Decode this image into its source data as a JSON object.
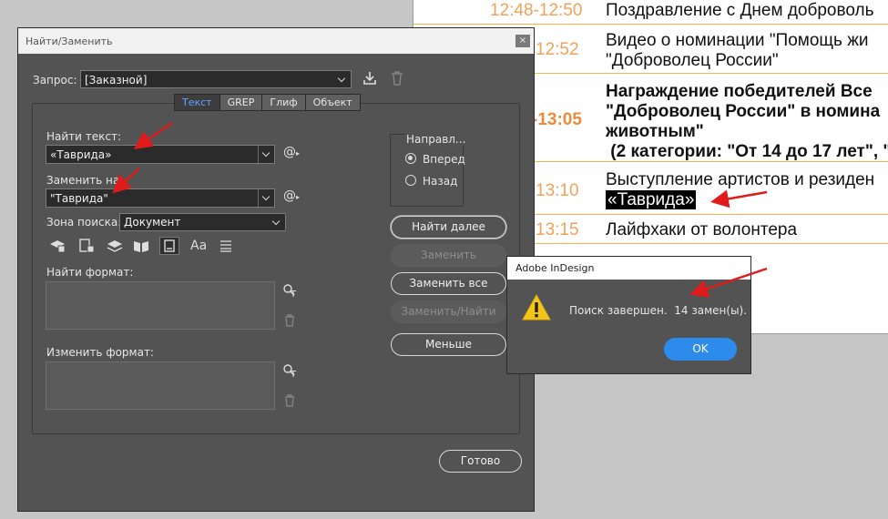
{
  "document": {
    "rows": [
      {
        "time": "12:48-12:50",
        "lines": [
          "Поздравление с Днем доброволь"
        ],
        "bold": false
      },
      {
        "time": "12:52",
        "lines": [
          "Видео о номинации \"Помощь жи",
          "\"Доброволец России\""
        ],
        "bold": false
      },
      {
        "time": "-13:05",
        "lines": [
          "Награждение победителей Все",
          "\"Доброволец России\" в номина",
          "животным\"",
          " (2 категории: \"От 14 до 17 лет\", \""
        ],
        "bold": true
      },
      {
        "time": "13:10",
        "lines": [
          "Выступление артистов и резиден"
        ],
        "highlight": "«Таврида»",
        "bold": false
      },
      {
        "time": "13:15",
        "lines": [
          "Лайфхаки от волонтера"
        ],
        "bold": false
      }
    ]
  },
  "dialog": {
    "title": "Найти/Заменить",
    "close": "×",
    "query_label": "Запрос:",
    "query_value": "[Заказной]",
    "tabs": [
      {
        "label": "Текст",
        "active": true
      },
      {
        "label": "GREP",
        "active": false
      },
      {
        "label": "Глиф",
        "active": false
      },
      {
        "label": "Объект",
        "active": false
      }
    ],
    "find_label": "Найти текст:",
    "find_value": "«Таврида»",
    "replace_label": "Заменить на:",
    "replace_value": "\"Таврида\"",
    "at_symbol": "@",
    "scope_label": "Зона поиска:",
    "scope_value": "Документ",
    "find_format_label": "Найти формат:",
    "change_format_label": "Изменить формат:",
    "direction": {
      "title": "Направл...",
      "forward": "Вперед",
      "back": "Назад"
    },
    "buttons": {
      "find_next": "Найти далее",
      "replace": "Заменить",
      "replace_all": "Заменить все",
      "replace_find": "Заменить/Найти",
      "less": "Меньше",
      "done": "Готово"
    }
  },
  "alert": {
    "title": "Adobe InDesign",
    "message": "Поиск завершен.  14 замен(ы).",
    "ok": "OK"
  },
  "colors": {
    "dialog_bg": "#535353",
    "active_tab_text": "#66a3ff",
    "ok_button": "#2d8ceb",
    "annotation_arrow": "#e01b1b",
    "doc_time": "#f0a25a",
    "doc_rule": "#f0b347"
  }
}
